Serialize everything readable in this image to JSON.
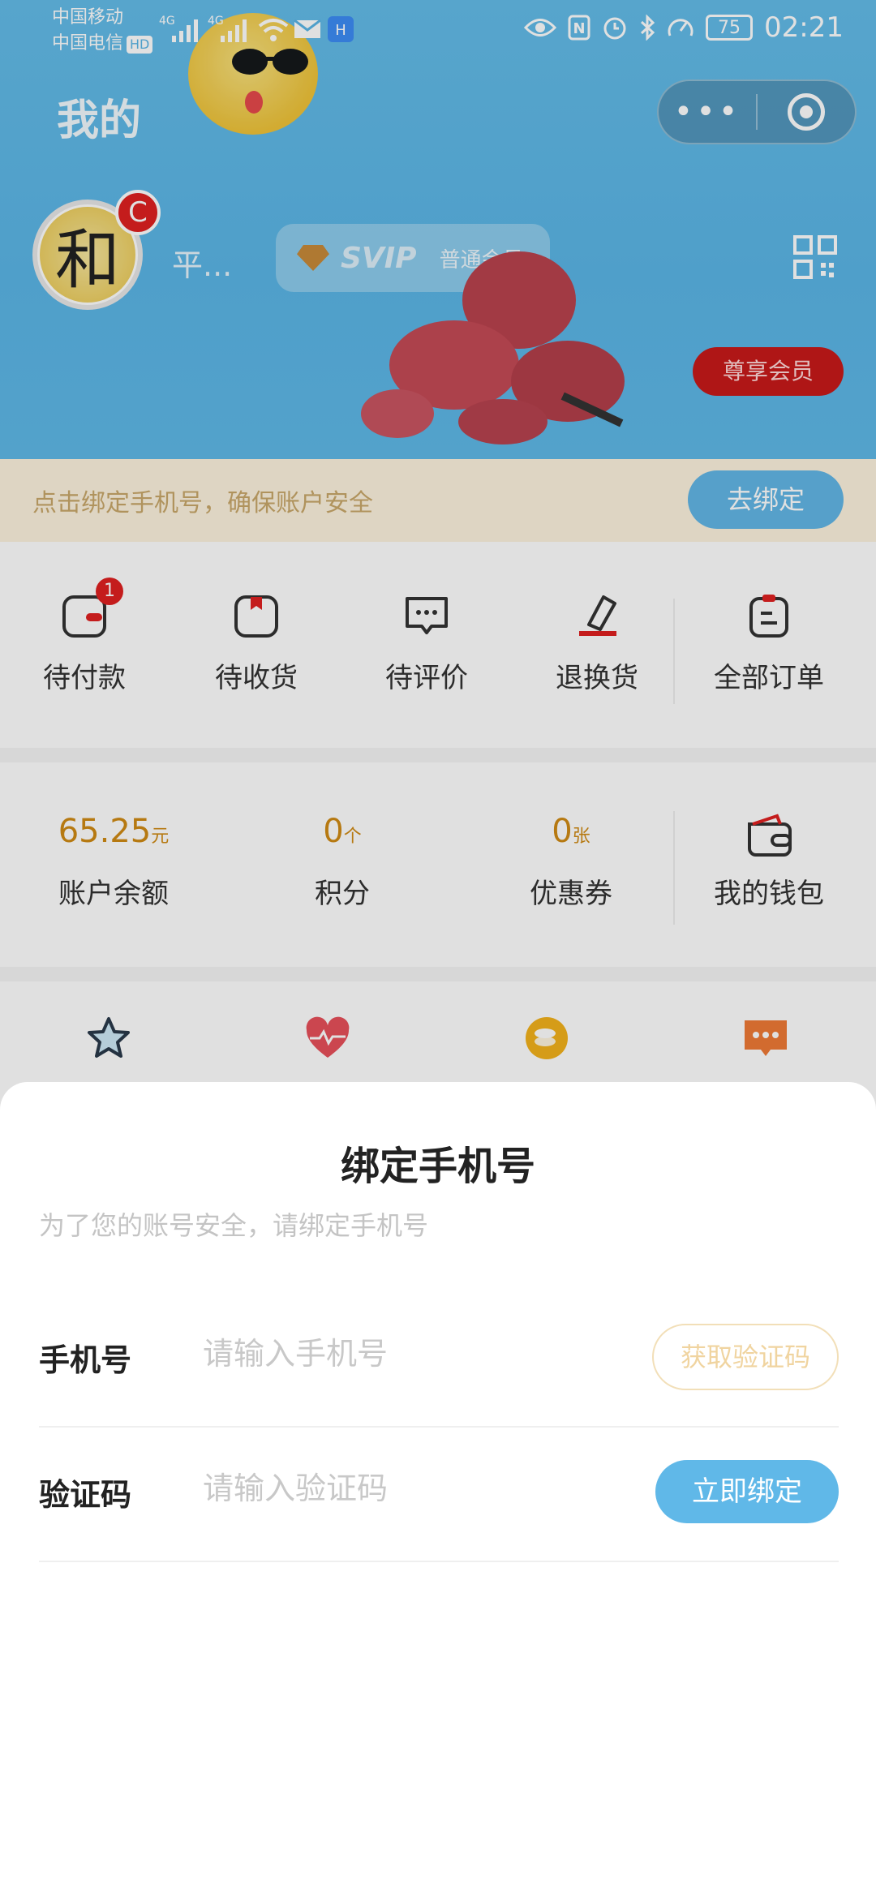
{
  "status_bar": {
    "carrier1": "中国移动",
    "carrier2": "中国电信",
    "hd": "HD",
    "net1": "4G",
    "net2": "4G",
    "battery": "75",
    "time": "02:21"
  },
  "header": {
    "title": "我的",
    "nickname": "平...",
    "svip": "SVIP",
    "member_level": "普通会员",
    "vip_button": "尊享会员",
    "capsule_more": "•••"
  },
  "bind_bar": {
    "text": "点击绑定手机号，确保账户安全",
    "button": "去绑定"
  },
  "orders": [
    {
      "label": "待付款",
      "badge": "1"
    },
    {
      "label": "待收货"
    },
    {
      "label": "待评价"
    },
    {
      "label": "退换货"
    },
    {
      "label": "全部订单"
    }
  ],
  "wallet": {
    "balance_value": "65.25",
    "balance_unit": "元",
    "balance_label": "账户余额",
    "points_value": "0",
    "points_unit": "个",
    "points_label": "积分",
    "coupons_value": "0",
    "coupons_unit": "张",
    "coupons_label": "优惠券",
    "wallet_label": "我的钱包"
  },
  "tools": [
    "star-icon",
    "heart-pulse-icon",
    "coin-icon",
    "message-icon"
  ],
  "sheet": {
    "title": "绑定手机号",
    "subtitle": "为了您的账号安全，请绑定手机号",
    "phone_label": "手机号",
    "phone_placeholder": "请输入手机号",
    "code_button": "获取验证码",
    "code_label": "验证码",
    "code_placeholder": "请输入验证码",
    "bind_button": "立即绑定"
  },
  "colors": {
    "accent_blue": "#60b8e8",
    "badge_red": "#e02020",
    "gold": "#d08a14"
  }
}
